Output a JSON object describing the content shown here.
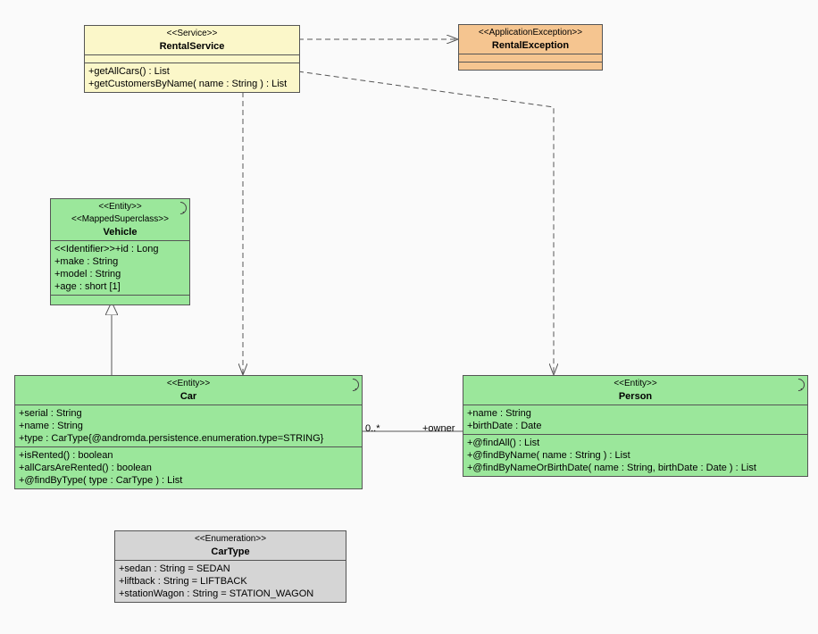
{
  "rentalService": {
    "stereo": "<<Service>>",
    "name": "RentalService",
    "ops": [
      "+getAllCars() : List",
      "+getCustomersByName( name : String ) : List"
    ]
  },
  "rentalException": {
    "stereo": "<<ApplicationException>>",
    "name": "RentalException"
  },
  "vehicle": {
    "stereo1": "<<Entity>>",
    "stereo2": "<<MappedSuperclass>>",
    "name": "Vehicle",
    "attrs": [
      "<<Identifier>>+id : Long",
      "+make : String",
      "+model : String",
      "+age : short [1]"
    ]
  },
  "car": {
    "stereo": "<<Entity>>",
    "name": "Car",
    "attrs": [
      "+serial : String",
      "+name : String",
      "+type : CarType{@andromda.persistence.enumeration.type=STRING}"
    ],
    "ops": [
      "+isRented() : boolean",
      "+allCarsAreRented() : boolean",
      "+@findByType( type : CarType ) : List"
    ]
  },
  "person": {
    "stereo": "<<Entity>>",
    "name": "Person",
    "attrs": [
      "+name : String",
      "+birthDate : Date"
    ],
    "ops": [
      "+@findAll() : List",
      "+@findByName( name : String ) : List",
      "+@findByNameOrBirthDate( name : String, birthDate : Date ) : List"
    ]
  },
  "carType": {
    "stereo": "<<Enumeration>>",
    "name": "CarType",
    "literals": [
      "+sedan : String = SEDAN",
      "+liftback : String = LIFTBACK",
      "+stationWagon : String = STATION_WAGON"
    ]
  },
  "assoc": {
    "carMult": "0..*",
    "ownerRole": "+owner"
  },
  "chart_data": {
    "type": "uml-class-diagram",
    "classes": [
      {
        "name": "RentalService",
        "stereotypes": [
          "Service"
        ],
        "operations": [
          "getAllCars():List",
          "getCustomersByName(name:String):List"
        ]
      },
      {
        "name": "RentalException",
        "stereotypes": [
          "ApplicationException"
        ]
      },
      {
        "name": "Vehicle",
        "stereotypes": [
          "Entity",
          "MappedSuperclass"
        ],
        "attributes": [
          "id:Long <<Identifier>>",
          "make:String",
          "model:String",
          "age:short[1]"
        ]
      },
      {
        "name": "Car",
        "stereotypes": [
          "Entity"
        ],
        "attributes": [
          "serial:String",
          "name:String",
          "type:CarType{@andromda.persistence.enumeration.type=STRING}"
        ],
        "operations": [
          "isRented():boolean",
          "allCarsAreRented():boolean",
          "@findByType(type:CarType):List"
        ]
      },
      {
        "name": "Person",
        "stereotypes": [
          "Entity"
        ],
        "attributes": [
          "name:String",
          "birthDate:Date"
        ],
        "operations": [
          "@findAll():List",
          "@findByName(name:String):List",
          "@findByNameOrBirthDate(name:String,birthDate:Date):List"
        ]
      },
      {
        "name": "CarType",
        "stereotypes": [
          "Enumeration"
        ],
        "literals": [
          "sedan=SEDAN",
          "liftback=LIFTBACK",
          "stationWagon=STATION_WAGON"
        ]
      }
    ],
    "relationships": [
      {
        "from": "RentalService",
        "to": "RentalException",
        "kind": "dependency"
      },
      {
        "from": "RentalService",
        "to": "Car",
        "kind": "dependency"
      },
      {
        "from": "RentalService",
        "to": "Person",
        "kind": "dependency"
      },
      {
        "from": "Car",
        "to": "Vehicle",
        "kind": "generalization"
      },
      {
        "from": "Car",
        "to": "Person",
        "kind": "association",
        "carEnd": "0..*",
        "personEnd": "+owner"
      }
    ]
  }
}
